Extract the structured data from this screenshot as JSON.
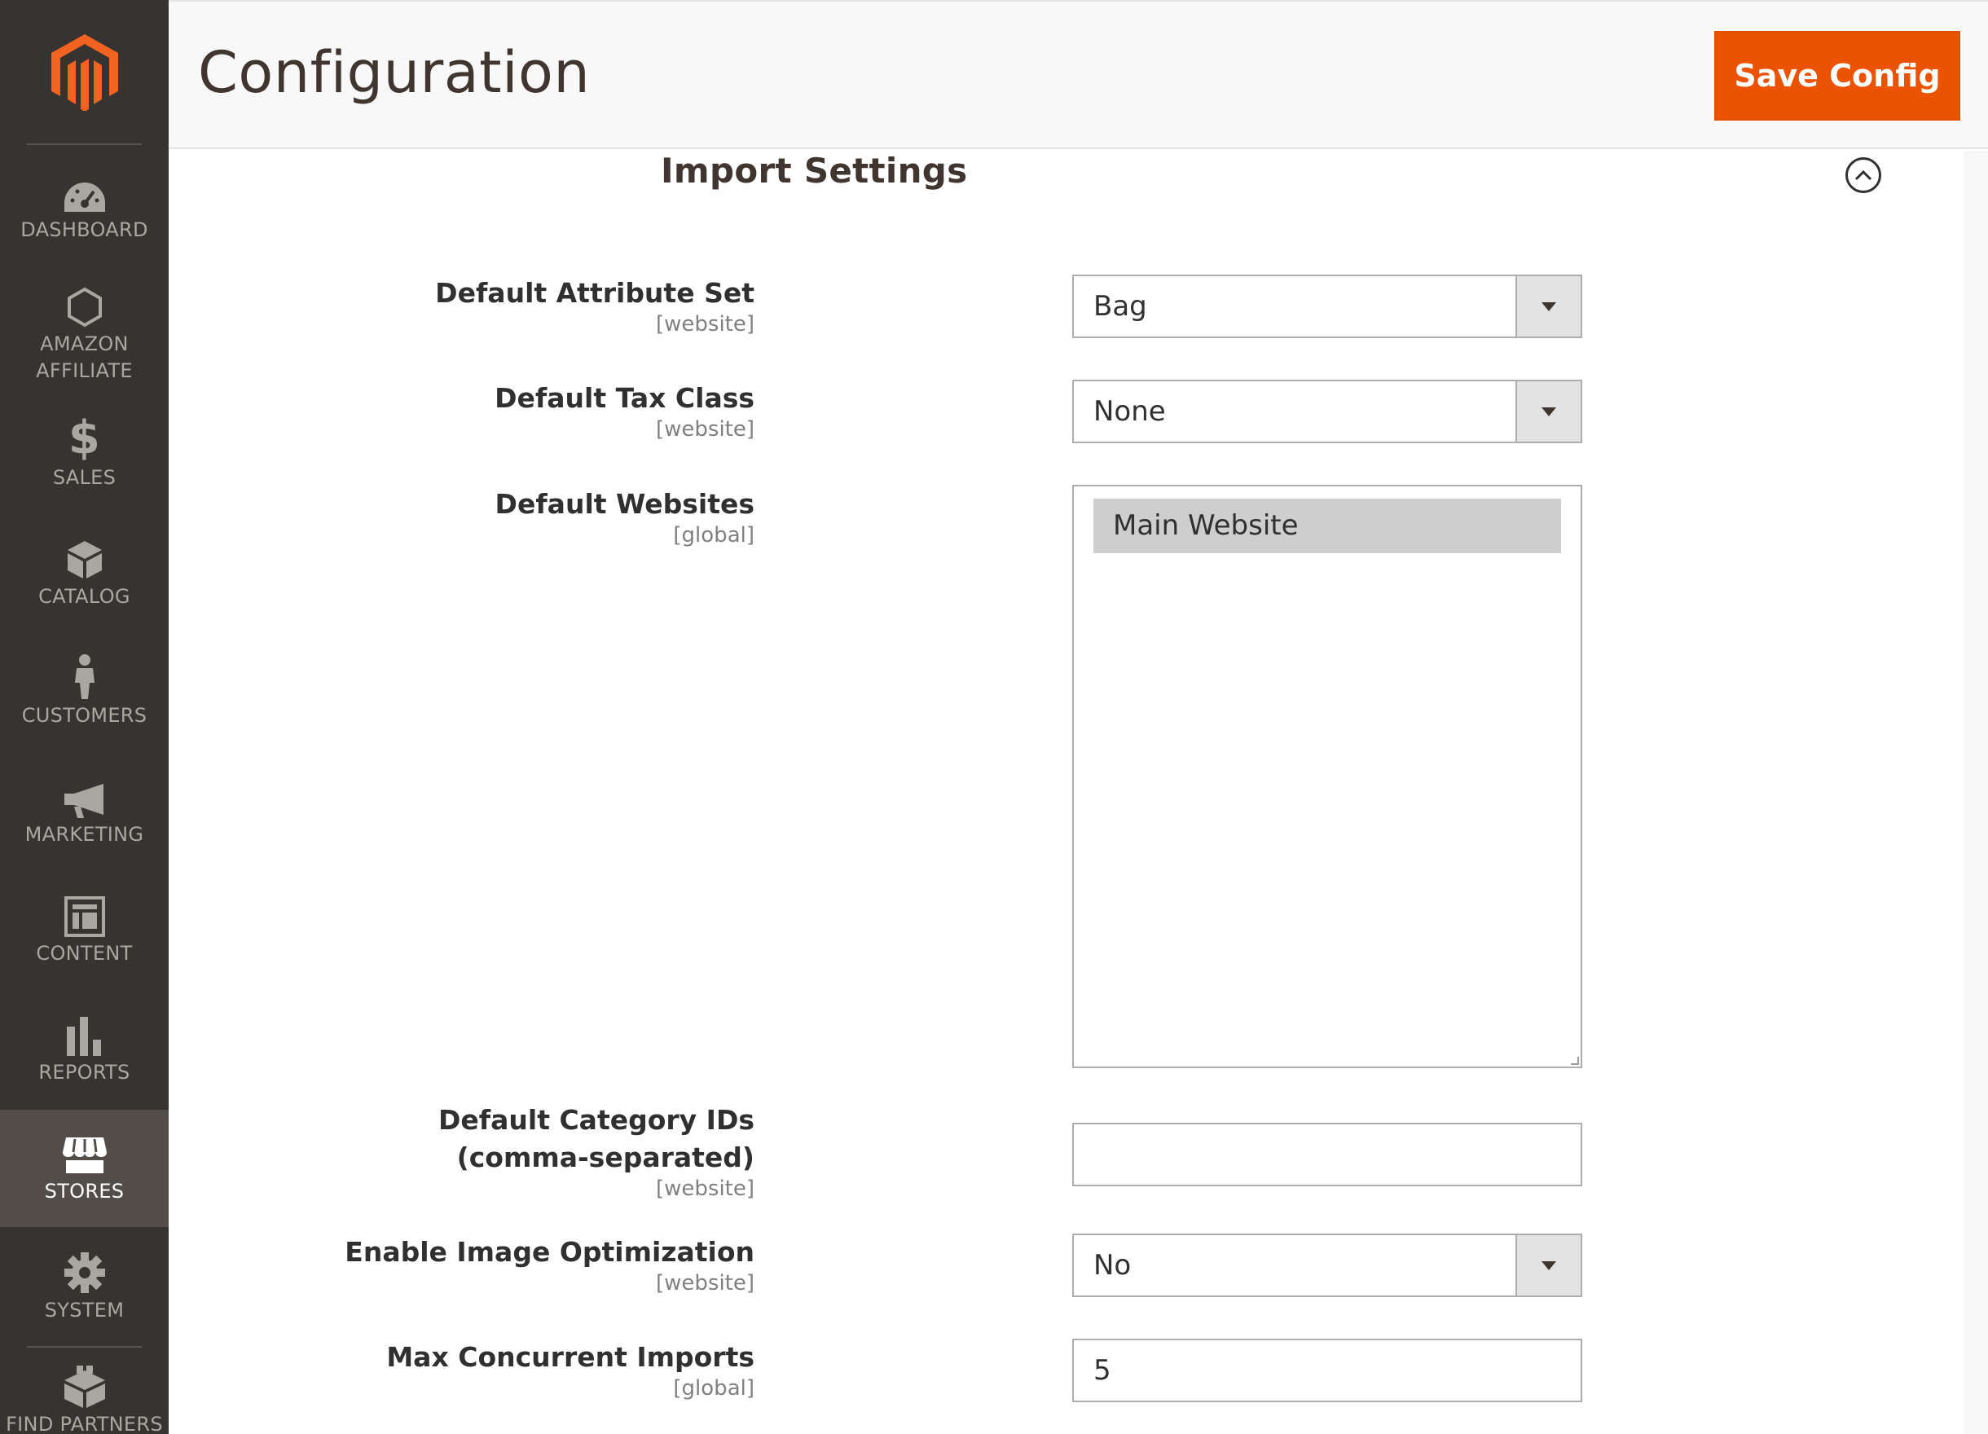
{
  "sidebar": {
    "items": [
      {
        "label": "DASHBOARD",
        "icon": "dashboard-icon"
      },
      {
        "label": "AMAZON AFFILIATE",
        "icon": "hexagon-icon"
      },
      {
        "label": "SALES",
        "icon": "dollar-icon"
      },
      {
        "label": "CATALOG",
        "icon": "box-icon"
      },
      {
        "label": "CUSTOMERS",
        "icon": "person-icon"
      },
      {
        "label": "MARKETING",
        "icon": "megaphone-icon"
      },
      {
        "label": "CONTENT",
        "icon": "layout-icon"
      },
      {
        "label": "REPORTS",
        "icon": "bar-chart-icon"
      },
      {
        "label": "STORES",
        "icon": "storefront-icon",
        "active": true
      },
      {
        "label": "SYSTEM",
        "icon": "gear-icon"
      },
      {
        "label": "FIND PARTNERS",
        "icon": "blocks-icon"
      }
    ]
  },
  "header": {
    "title": "Configuration",
    "save_label": "Save Config"
  },
  "section": {
    "title": "Import Settings"
  },
  "fields": {
    "attribute_set": {
      "label": "Default Attribute Set",
      "scope": "[website]",
      "value": "Bag"
    },
    "tax_class": {
      "label": "Default Tax Class",
      "scope": "[website]",
      "value": "None"
    },
    "websites": {
      "label": "Default Websites",
      "scope": "[global]",
      "options": [
        "Main Website"
      ]
    },
    "category_ids": {
      "label_line1": "Default Category IDs",
      "label_line2": "(comma-separated)",
      "scope": "[website]",
      "value": ""
    },
    "image_optimization": {
      "label": "Enable Image Optimization",
      "scope": "[website]",
      "value": "No"
    },
    "max_imports": {
      "label": "Max Concurrent Imports",
      "scope": "[global]",
      "value": "5"
    }
  },
  "colors": {
    "sidebar_bg": "#373330",
    "accent": "#eb5202",
    "active_nav": "#524d49"
  }
}
